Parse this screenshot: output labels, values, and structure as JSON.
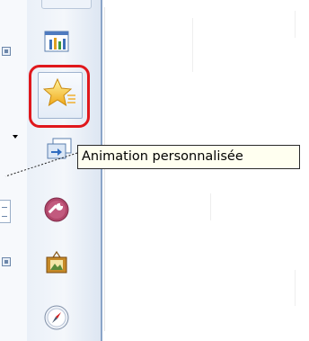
{
  "tooltip": {
    "text": "Animation personnalisée"
  },
  "colors": {
    "highlight": "#e0181c",
    "tooltip_bg": "#fffff0",
    "separator": "#8aa4c8"
  },
  "toolbar": {
    "items": [
      {
        "icon": "chart-icon"
      },
      {
        "icon": "star-icon",
        "highlighted": true
      },
      {
        "icon": "slide-transition-icon"
      },
      {
        "icon": "wrench-icon"
      },
      {
        "icon": "picture-frame-icon"
      },
      {
        "icon": "compass-icon"
      }
    ]
  }
}
